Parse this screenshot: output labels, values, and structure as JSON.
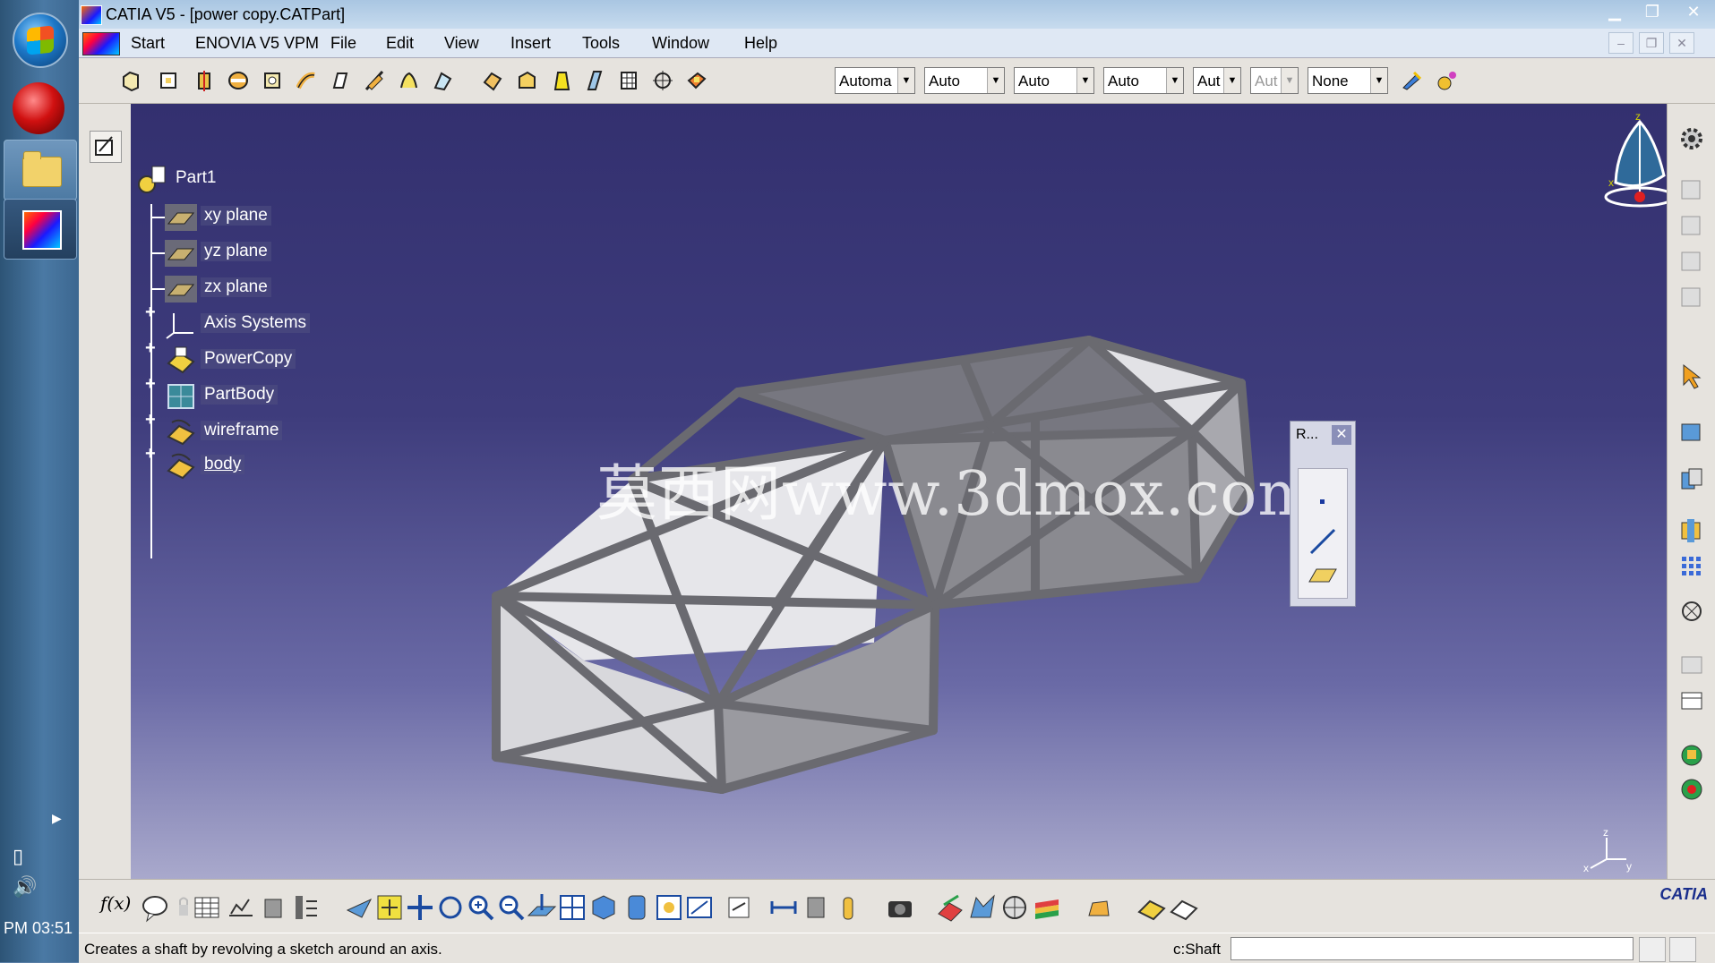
{
  "window": {
    "title": "CATIA V5 - [power copy.CATPart]"
  },
  "taskbar": {
    "clock": "PM 03:51"
  },
  "menu": {
    "items": [
      "Start",
      "ENOVIA V5 VPM",
      "File",
      "Edit",
      "View",
      "Insert",
      "Tools",
      "Window",
      "Help"
    ]
  },
  "toolbar": {
    "combos": [
      {
        "value": "Automa",
        "disabled": false
      },
      {
        "value": "Auto",
        "disabled": false
      },
      {
        "value": "Auto",
        "disabled": false
      },
      {
        "value": "Auto",
        "disabled": false
      },
      {
        "value": "Aut",
        "disabled": false
      },
      {
        "value": "Aut",
        "disabled": true
      },
      {
        "value": "None",
        "disabled": false
      }
    ]
  },
  "tree": {
    "root": "Part1",
    "nodes": [
      {
        "label": "xy plane",
        "icon": "plane-icon",
        "expandable": false
      },
      {
        "label": "yz plane",
        "icon": "plane-icon",
        "expandable": false
      },
      {
        "label": "zx plane",
        "icon": "plane-icon",
        "expandable": false
      },
      {
        "label": "Axis Systems",
        "icon": "axis-system-icon",
        "expandable": true
      },
      {
        "label": "PowerCopy",
        "icon": "powercopy-icon",
        "expandable": true
      },
      {
        "label": "PartBody",
        "icon": "partbody-icon",
        "expandable": true
      },
      {
        "label": "wireframe",
        "icon": "geometrical-set-icon",
        "expandable": true
      },
      {
        "label": "body",
        "icon": "geometrical-set-icon",
        "expandable": true
      }
    ]
  },
  "viewport": {
    "watermark": "莫西网www.3dmox.com",
    "compass_labels": {
      "z": "z",
      "x": "x",
      "y": "y"
    }
  },
  "float_panel": {
    "title": "R..."
  },
  "bottom": {
    "brand": "CATIA"
  },
  "status": {
    "message": "Creates a shaft by revolving a sketch around an axis.",
    "command_label": "c:Shaft",
    "command_value": ""
  },
  "colors": {
    "background_top": "#33306f",
    "background_bottom": "#a9a9cc",
    "frame": "#7a7a7a"
  }
}
